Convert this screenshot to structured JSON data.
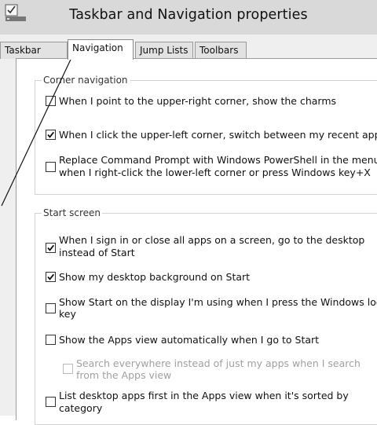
{
  "window": {
    "title": "Taskbar and Navigation properties",
    "icon": "taskbar-app-icon"
  },
  "tabs": [
    {
      "label": "Taskbar",
      "active": false
    },
    {
      "label": "Navigation",
      "active": true
    },
    {
      "label": "Jump Lists",
      "active": false
    },
    {
      "label": "Toolbars",
      "active": false
    }
  ],
  "corner_navigation": {
    "legend": "Corner navigation",
    "options": [
      {
        "label": "When I point to the upper-right corner, show the charms",
        "checked": false
      },
      {
        "label": "When I click the upper-left corner, switch between my recent apps",
        "checked": true
      },
      {
        "label_lines": [
          "Replace Command Prompt with Windows PowerShell in the menu",
          "when I right-click the lower-left corner or press Windows key+X"
        ],
        "checked": false
      }
    ]
  },
  "start_screen": {
    "legend": "Start screen",
    "options": [
      {
        "label_lines": [
          "When I sign in or close all apps on a screen, go to the desktop",
          "instead of Start"
        ],
        "checked": true
      },
      {
        "label": "Show my desktop background on Start",
        "checked": true
      },
      {
        "label_lines": [
          "Show Start on the display I'm using when I press the Windows logo",
          "key"
        ],
        "checked": false
      },
      {
        "label": "Show the Apps view automatically when I go to Start",
        "checked": false
      },
      {
        "label_lines": [
          "Search everywhere instead of just my apps when I search",
          "from the Apps view"
        ],
        "checked": false,
        "disabled": true
      },
      {
        "label_lines": [
          "List desktop apps first in the Apps view when it's sorted by",
          "category"
        ],
        "checked": false
      }
    ]
  }
}
